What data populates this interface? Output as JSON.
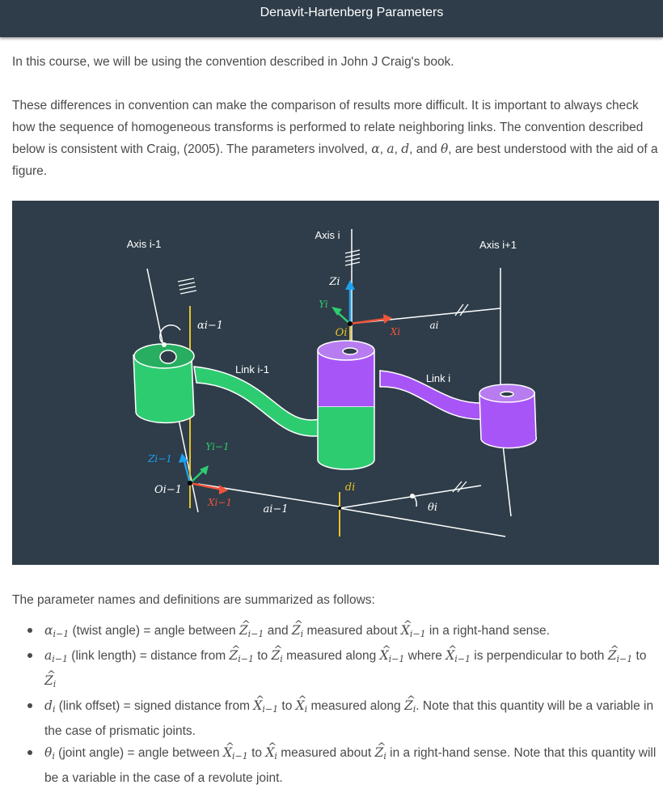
{
  "header": {
    "title": "Denavit-Hartenberg Parameters"
  },
  "intro": {
    "p1": "In this course, we will be using the convention described in John J Craig's book.",
    "p2_a": "These differences in convention can make the comparison of results more difficult. It is important to always check how the sequence of homogeneous transforms is performed to relate neighboring links. The convention described below is consistent with Craig, (2005). The parameters involved, ",
    "p2_alpha": "α",
    "p2_sep1": ", ",
    "p2_a_sym": "a",
    "p2_sep2": ", ",
    "p2_d": "d",
    "p2_sep3": ", and ",
    "p2_theta": "θ",
    "p2_b": ", are best understood with the aid of a figure."
  },
  "figure": {
    "axis_im1": "Axis i-1",
    "axis_i": "Axis i",
    "axis_ip1": "Axis i+1",
    "link_im1": "Link i-1",
    "link_i": "Link i",
    "alpha_im1": "αi−1",
    "z_i": "Zi",
    "y_i": "Yi",
    "o_i": "Oi",
    "x_i": "Xi",
    "a_i": "ai",
    "y_im1": "Yi−1",
    "z_im1": "Zi−1",
    "o_im1": "Oi−1",
    "x_im1": "Xi−1",
    "a_im1": "ai−1",
    "d_i": "di",
    "theta_i": "θi",
    "colors": {
      "background": "#2e3d49",
      "green": "#2ecc71",
      "purple": "#a855f7",
      "red": "#f0533a",
      "blue": "#1da1f2",
      "yellow": "#e6c229"
    }
  },
  "summary": "The parameter names and definitions are summarized as follows:",
  "definitions": [
    {
      "sym": "α",
      "sub": "i−1",
      "text_a": " (twist angle) = angle between ",
      "s1": "Z",
      "s1sub": "i−1",
      "mid1": " and ",
      "s2": "Z",
      "s2sub": "i",
      "text_b": " measured about ",
      "s3": "X",
      "s3sub": "i−1",
      "text_c": " in a right-hand sense."
    },
    {
      "sym": "a",
      "sub": "i−1",
      "text_a": " (link length) = distance from ",
      "s1": "Z",
      "s1sub": "i−1",
      "mid1": " to ",
      "s2": "Z",
      "s2sub": "i",
      "text_b": " measured along ",
      "s3": "X",
      "s3sub": "i−1",
      "text_c": " where ",
      "s4": "X",
      "s4sub": "i−1",
      "text_d": " is perpendicular to both ",
      "s5": "Z",
      "s5sub": "i−1",
      "mid2": " to ",
      "s6": "Z",
      "s6sub": "i"
    },
    {
      "sym": "d",
      "sub": "i",
      "text_a": " (link offset) = signed distance from ",
      "s1": "X",
      "s1sub": "i−1",
      "mid1": " to ",
      "s2": "X",
      "s2sub": "i",
      "text_b": " measured along ",
      "s3": "Z",
      "s3sub": "i",
      "text_c": ". Note that this quantity will be a variable in the case of prismatic joints."
    },
    {
      "sym": "θ",
      "sub": "i",
      "text_a": " (joint angle) = angle between ",
      "s1": "X",
      "s1sub": "i−1",
      "mid1": " to ",
      "s2": "X",
      "s2sub": "i",
      "text_b": " measured about ",
      "s3": "Z",
      "s3sub": "i",
      "text_c": " in a right-hand sense. Note that this quantity will be a variable in the case of a revolute joint."
    }
  ]
}
